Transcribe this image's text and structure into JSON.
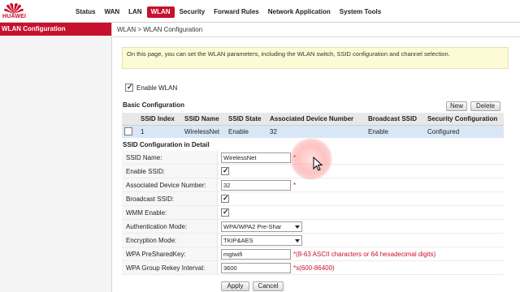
{
  "brand": {
    "name": "HUAWEI",
    "logo_icon": "huawei-petal-logo",
    "brand_color": "#c8102e"
  },
  "nav": {
    "items": [
      "Status",
      "WAN",
      "LAN",
      "WLAN",
      "Security",
      "Forward Rules",
      "Network Application",
      "System Tools"
    ],
    "active": "WLAN"
  },
  "sidebar": {
    "active_item": "WLAN Configuration"
  },
  "breadcrumb": "WLAN > WLAN Configuration",
  "info_text": "On this page, you can set the WLAN parameters, including the WLAN switch, SSID configuration and channel selection.",
  "enable_wlan": {
    "label": "Enable WLAN",
    "checked": true
  },
  "basic": {
    "title": "Basic Configuration",
    "new_label": "New",
    "delete_label": "Delete",
    "columns": [
      "SSID Index",
      "SSID Name",
      "SSID State",
      "Associated Device Number",
      "Broadcast SSID",
      "Security Configuration"
    ],
    "rows": [
      {
        "index": "1",
        "name": "WirelessNet",
        "state": "Enable",
        "devices": "32",
        "broadcast": "Enable",
        "security": "Configured"
      }
    ]
  },
  "detail": {
    "title": "SSID Configuration in Detail",
    "ssid_name": {
      "label": "SSID Name:",
      "value": "WirelessNet",
      "required": "*"
    },
    "enable_ssid": {
      "label": "Enable SSID:",
      "checked": true
    },
    "assoc_devices": {
      "label": "Associated Device Number:",
      "value": "32",
      "required": "*"
    },
    "broadcast_ssid": {
      "label": "Broadcast SSID:",
      "checked": true
    },
    "wmm_enable": {
      "label": "WMM Enable:",
      "checked": true
    },
    "auth_mode": {
      "label": "Authentication Mode:",
      "value": "WPA/WPA2 Pre-Shar"
    },
    "encryption_mode": {
      "label": "Encryption Mode:",
      "value": "TKIP&AES"
    },
    "wpa_psk": {
      "label": "WPA PreSharedKey:",
      "value": "mgtwifi",
      "hint": "*(8-63 ASCII characters or 64 hexadecimal digits)"
    },
    "wpa_rekey": {
      "label": "WPA Group Rekey Interval:",
      "value": "3600",
      "hint": "*s(600-86400)"
    }
  },
  "actions": {
    "apply_label": "Apply",
    "cancel_label": "Cancel"
  }
}
